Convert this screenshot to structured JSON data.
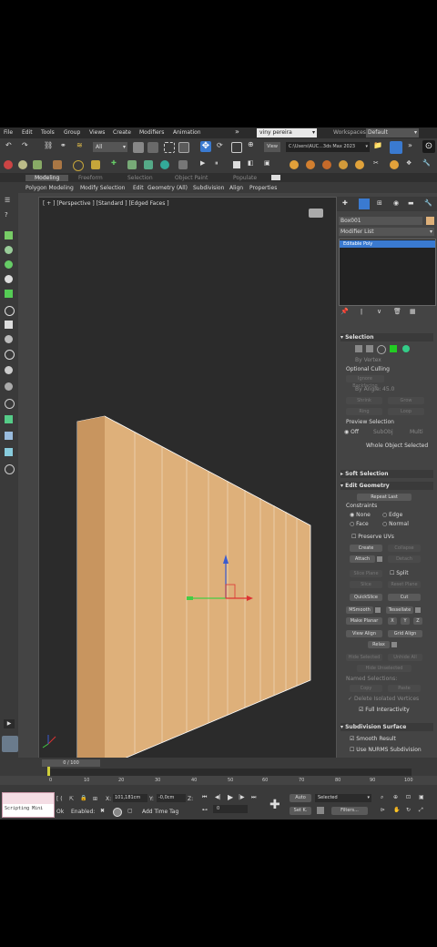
{
  "menu": {
    "items": [
      "File",
      "Edit",
      "Tools",
      "Group",
      "Views",
      "Create",
      "Modifiers",
      "Animation"
    ],
    "more": "»",
    "user": "viny pereira",
    "workspaces_label": "Workspaces:",
    "workspace_value": "Default"
  },
  "toolbar": {
    "filter": "All",
    "view_label": "View",
    "path": "C:\\Users\\AUC...3ds Max 2023"
  },
  "ribbon": {
    "tabs": [
      "Modeling",
      "Freeform",
      "Selection",
      "Object Paint",
      "Populate"
    ],
    "items": [
      "Polygon Modeling",
      "Modify Selection",
      "Edit",
      "Geometry (All)",
      "Subdivision",
      "Align",
      "Properties"
    ]
  },
  "viewport": {
    "label": "[ + ] [Perspective ] [Standard ] [Edged Faces ]"
  },
  "panel": {
    "object_name": "Box001",
    "modifier_list": "Modifier List",
    "stack_item": "Editable Poly",
    "selection": {
      "title": "Selection",
      "by_vertex": "By Vertex",
      "ignore_backfacing": "Ignore Backfacing",
      "by_angle": "By Angle:",
      "angle": "45.0",
      "shrink": "Shrink",
      "grow": "Grow",
      "ring": "Ring",
      "loop": "Loop",
      "preview_label": "Preview Selection",
      "off": "Off",
      "subobj": "SubObj",
      "multi": "Multi",
      "whole": "Whole Object Selected",
      "optional_culling": "Optional Culling"
    },
    "soft_selection": "Soft Selection",
    "edit_geometry": {
      "title": "Edit Geometry",
      "repeat_last": "Repeat Last",
      "constraints": "Constraints",
      "none": "None",
      "edge": "Edge",
      "face": "Face",
      "normal": "Normal",
      "preserve_uvs": "Preserve UVs",
      "create": "Create",
      "collapse": "Collapse",
      "attach": "Attach",
      "detach": "Detach",
      "slice_plane": "Slice Plane",
      "split": "Split",
      "slice": "Slice",
      "reset_plane": "Reset Plane",
      "quickslice": "QuickSlice",
      "cut": "Cut",
      "msmooth": "MSmooth",
      "tessellate": "Tessellate",
      "make_planar": "Make Planar",
      "x": "X",
      "y": "Y",
      "z": "Z",
      "view_align": "View Align",
      "grid_align": "Grid Align",
      "relax": "Relax",
      "hide_selected": "Hide Selected",
      "unhide_all": "Unhide All",
      "hide_unselected": "Hide Unselected",
      "named_selections": "Named Selections:",
      "copy": "Copy",
      "paste": "Paste",
      "delete_isolated": "Delete Isolated Vertices",
      "full_interactivity": "Full Interactivity"
    },
    "subdivision": {
      "title": "Subdivision Surface",
      "smooth_result": "Smooth Result",
      "use_nurms": "Use NURMS Subdivision"
    }
  },
  "timeline": {
    "frame": "0 / 100",
    "ticks": [
      "0",
      "10",
      "20",
      "30",
      "40",
      "50",
      "60",
      "70",
      "80",
      "90",
      "100"
    ]
  },
  "status": {
    "script": "Scripting Mini",
    "ok": "Ok",
    "x_label": "X:",
    "x_value": "101,181cm",
    "y_label": "Y:",
    "y_value": "-0,0cm",
    "z_label": "Z:",
    "enabled": "Enabled:",
    "add_time_tag": "Add Time Tag",
    "auto": "Auto",
    "selected": "Selected",
    "set_k": "Set K.",
    "filters": "Filters...",
    "frame_field": "0"
  },
  "colors": {
    "accent": "#4b8fd6",
    "wall": "#deb07a",
    "panel_bg": "#444444",
    "viewport_bg": "#2b2b2b"
  }
}
